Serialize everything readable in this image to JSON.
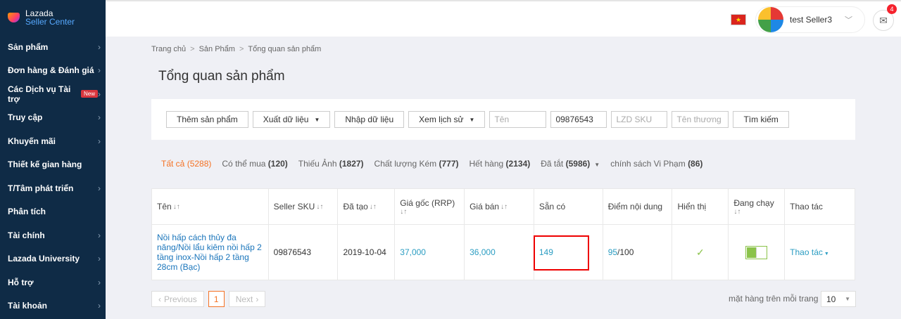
{
  "brand": {
    "line1": "Lazada",
    "line2": "Seller Center"
  },
  "sidebar": {
    "items": [
      {
        "label": "Sản phẩm",
        "chevron": true
      },
      {
        "label": "Đơn hàng & Đánh giá",
        "chevron": true
      },
      {
        "label": "Các Dịch vụ Tài trợ",
        "chevron": true,
        "badge": "New"
      },
      {
        "label": "Truy cập",
        "chevron": true
      },
      {
        "label": "Khuyến mãi",
        "chevron": true
      },
      {
        "label": "Thiết kế gian hàng",
        "chevron": false
      },
      {
        "label": "T/Tâm phát triển",
        "chevron": true
      },
      {
        "label": "Phân tích",
        "chevron": false
      },
      {
        "label": "Tài chính",
        "chevron": true
      },
      {
        "label": "Lazada University",
        "chevron": true
      },
      {
        "label": "Hỗ trợ",
        "chevron": true
      },
      {
        "label": "Tài khoản",
        "chevron": true
      }
    ]
  },
  "header": {
    "user_name": "test Seller3",
    "mail_count": "4",
    "flag_symbol": "★"
  },
  "breadcrumb": [
    "Trang chủ",
    "Sản Phẩm",
    "Tổng quan sản phẩm"
  ],
  "page_title": "Tổng quan sản phẩm",
  "toolbar": {
    "add_product": "Thêm sản phẩm",
    "export": "Xuất dữ liệu",
    "import": "Nhập dữ liệu",
    "history": "Xem lịch sử",
    "name_placeholder": "Tên",
    "seller_sku_value": "09876543",
    "lzd_sku_placeholder": "LZD SKU",
    "brand_placeholder": "Tên thương hiệu",
    "search": "Tìm kiếm"
  },
  "tabs": [
    {
      "label": "Tất cả",
      "count": "(5288)",
      "active": true
    },
    {
      "label": "Có thể mua",
      "count": "(120)"
    },
    {
      "label": "Thiếu Ảnh",
      "count": "(1827)"
    },
    {
      "label": "Chất lượng Kém",
      "count": "(777)"
    },
    {
      "label": "Hết hàng",
      "count": "(2134)"
    },
    {
      "label": "Đã tắt",
      "count": "(5986)",
      "dropdown": true
    },
    {
      "label": "chính sách Vi Phạm",
      "count": "(86)"
    }
  ],
  "table": {
    "headers": {
      "name": "Tên",
      "seller_sku": "Seller SKU",
      "created": "Đã tạo",
      "rrp": "Giá gốc (RRP)",
      "price": "Giá bán",
      "stock": "Sẵn có",
      "content_score": "Điểm nội dung",
      "visible": "Hiển thị",
      "active": "Đang chạy",
      "actions": "Thao tác"
    },
    "rows": [
      {
        "name": "Nồi hấp cách thủy đa năng/Nồi lẩu kiêm nồi hấp 2 tầng inox-Nồi hấp 2 tầng 28cm (Bạc)",
        "seller_sku": "09876543",
        "created": "2019-10-04",
        "rrp": "37,000",
        "price": "36,000",
        "stock": "149",
        "score": "95",
        "score_total": "/100",
        "visible_mark": "✓",
        "active": true,
        "action": "Thao tác"
      }
    ]
  },
  "pagination": {
    "prev": "Previous",
    "page": "1",
    "next": "Next",
    "per_page_label": "mặt hàng trên mỗi trang",
    "per_page_value": "10"
  }
}
